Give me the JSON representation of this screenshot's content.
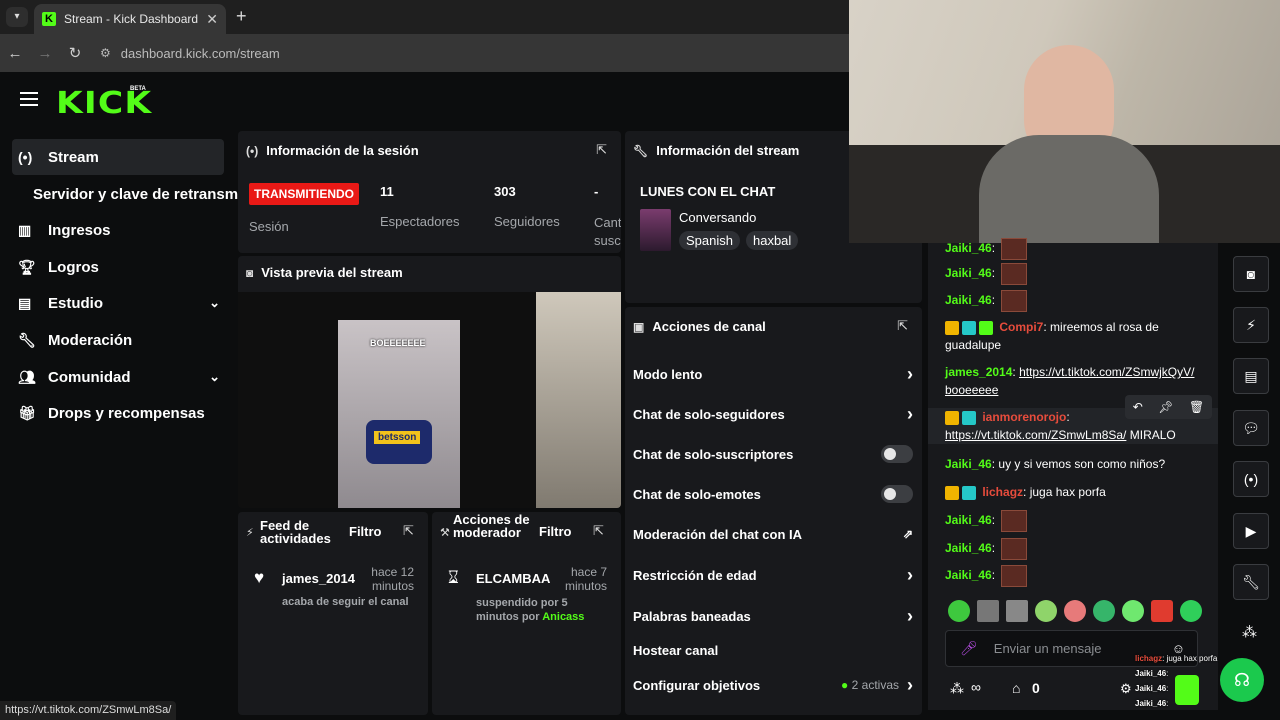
{
  "browser": {
    "tab_title": "Stream - Kick Dashboard",
    "url": "dashboard.kick.com/stream",
    "status_url": "https://vt.tiktok.com/ZSmwLm8Sa/"
  },
  "brand": {
    "logo": "KICK",
    "beta": "BETA",
    "accent": "#53fc18"
  },
  "sidebar": {
    "items": [
      {
        "label": "Stream",
        "icon": "broadcast-icon"
      },
      {
        "label": "Servidor y clave de retransmisión"
      },
      {
        "label": "Ingresos",
        "icon": "chart-icon"
      },
      {
        "label": "Logros",
        "icon": "trophy-icon"
      },
      {
        "label": "Estudio",
        "icon": "studio-icon"
      },
      {
        "label": "Moderación",
        "icon": "wrench-icon"
      },
      {
        "label": "Comunidad",
        "icon": "community-icon"
      },
      {
        "label": "Drops y recompensas",
        "icon": "gift-icon"
      }
    ]
  },
  "session": {
    "title": "Información de la sesión",
    "live_badge": "TRANSMITIENDO",
    "session_label": "Sesión",
    "stats": [
      {
        "value": "11",
        "label": "Espectadores"
      },
      {
        "value": "303",
        "label": "Seguidores"
      },
      {
        "value": "-",
        "label": "Canti\nsusc"
      }
    ]
  },
  "stream_info": {
    "title": "Información del stream",
    "stream_title": "LUNES CON EL CHAT",
    "category": "Conversando",
    "tags": [
      "Spanish",
      "haxbal"
    ]
  },
  "preview": {
    "title": "Vista previa del stream",
    "inner_label": "BOEEEEEEE",
    "jersey": "betsson"
  },
  "channel_actions": {
    "title": "Acciones de canal",
    "items": [
      {
        "label": "Modo lento",
        "control": "chevron"
      },
      {
        "label": "Chat de solo-seguidores",
        "control": "chevron"
      },
      {
        "label": "Chat de solo-suscriptores",
        "control": "toggle"
      },
      {
        "label": "Chat de solo-emotes",
        "control": "toggle"
      },
      {
        "label": "Moderación del chat con IA",
        "control": "external"
      },
      {
        "label": "Restricción de edad",
        "control": "chevron"
      },
      {
        "label": "Palabras baneadas",
        "control": "chevron"
      },
      {
        "label": "Hostear canal",
        "control": "none"
      },
      {
        "label": "Configurar objetivos",
        "control": "chevron",
        "extra": "2 activas"
      }
    ]
  },
  "activity_feed": {
    "title": "Feed de actividades",
    "filter": "Filtro",
    "user": "james_2014",
    "time": "hace 12 minutos",
    "text": "acaba de seguir el canal"
  },
  "mod_actions": {
    "title": "Acciones de moderador",
    "filter": "Filtro",
    "user": "ELCAMBAA",
    "time": "hace 7 minutos",
    "text": "suspendido por 5 minutos por",
    "by": "Anicass"
  },
  "chat": {
    "placeholder": "Enviar un mensaje",
    "points": "∞",
    "count": "0",
    "messages": [
      {
        "user": "Jaiki_46",
        "text": "",
        "emote": true
      },
      {
        "user": "Jaiki_46",
        "text": "",
        "emote": true
      },
      {
        "user": "Jaiki_46",
        "text": "",
        "emote": true
      },
      {
        "user": "Compi7",
        "text": "mireemos al rosa de guadalupe"
      },
      {
        "user": "james_2014",
        "text": "https://vt.tiktok.com/ZSmwjkQyV/ booeeeee"
      },
      {
        "user": "ianmorenorojo",
        "text": "https://vt.tiktok.com/ZSmwLm8Sa/",
        "after": "MIRALO"
      },
      {
        "user": "Jaiki_46",
        "text": "uy y si vemos son como niños?"
      },
      {
        "user": "lichagz",
        "text": "juga hax porfa"
      },
      {
        "user": "Jaiki_46",
        "text": "",
        "emote": true
      },
      {
        "user": "Jaiki_46",
        "text": "",
        "emote": true
      },
      {
        "user": "Jaiki_46",
        "text": "",
        "emote": true
      }
    ],
    "overlay": [
      {
        "user": "lichagz",
        "text": "juga hax porfa"
      },
      {
        "user": "Jaiki_46",
        "text": ""
      },
      {
        "user": "Jaiki_46",
        "text": ""
      },
      {
        "user": "Jaiki_46",
        "text": ""
      }
    ]
  }
}
